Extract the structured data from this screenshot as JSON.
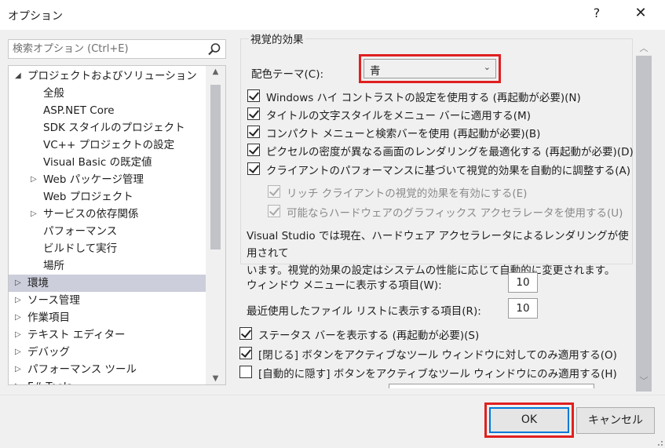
{
  "window": {
    "title": "オプション",
    "help_glyph": "?",
    "close_glyph": "✕"
  },
  "search": {
    "placeholder": "検索オプション (Ctrl+E)"
  },
  "tree": {
    "items": [
      {
        "label": "プロジェクトおよびソリューション",
        "level": 0,
        "expander": "◢",
        "selected": false
      },
      {
        "label": "全般",
        "level": 1,
        "expander": "",
        "selected": false
      },
      {
        "label": "ASP.NET Core",
        "level": 1,
        "expander": "",
        "selected": false
      },
      {
        "label": "SDK スタイルのプロジェクト",
        "level": 1,
        "expander": "",
        "selected": false
      },
      {
        "label": "VC++ プロジェクトの設定",
        "level": 1,
        "expander": "",
        "selected": false
      },
      {
        "label": "Visual Basic の既定値",
        "level": 1,
        "expander": "",
        "selected": false
      },
      {
        "label": "Web パッケージ管理",
        "level": 1,
        "expander": "▷",
        "selected": false
      },
      {
        "label": "Web プロジェクト",
        "level": 1,
        "expander": "",
        "selected": false
      },
      {
        "label": "サービスの依存関係",
        "level": 1,
        "expander": "▷",
        "selected": false
      },
      {
        "label": "パフォーマンス",
        "level": 1,
        "expander": "",
        "selected": false
      },
      {
        "label": "ビルドして実行",
        "level": 1,
        "expander": "",
        "selected": false
      },
      {
        "label": "場所",
        "level": 1,
        "expander": "",
        "selected": false
      },
      {
        "label": "環境",
        "level": 0,
        "expander": "▷",
        "selected": true
      },
      {
        "label": "ソース管理",
        "level": 0,
        "expander": "▷",
        "selected": false
      },
      {
        "label": "作業項目",
        "level": 0,
        "expander": "▷",
        "selected": false
      },
      {
        "label": "テキスト エディター",
        "level": 0,
        "expander": "▷",
        "selected": false
      },
      {
        "label": "デバッグ",
        "level": 0,
        "expander": "▷",
        "selected": false
      },
      {
        "label": "パフォーマンス ツール",
        "level": 0,
        "expander": "▷",
        "selected": false
      },
      {
        "label": "F# Tools",
        "level": 0,
        "expander": "▷",
        "selected": false
      }
    ]
  },
  "visual": {
    "group_title": "視覚的効果",
    "theme_label": "配色テーマ(C):",
    "theme_value": "青",
    "checkboxes": [
      {
        "label": "Windows ハイ コントラストの設定を使用する (再起動が必要)(N)",
        "checked": true,
        "disabled": false
      },
      {
        "label": "タイトルの文字スタイルをメニュー バーに適用する(M)",
        "checked": true,
        "disabled": false
      },
      {
        "label": "コンパクト メニューと検索バーを使用 (再起動が必要)(B)",
        "checked": true,
        "disabled": false
      },
      {
        "label": "ピクセルの密度が異なる画面のレンダリングを最適化する (再起動が必要)(D)",
        "checked": true,
        "disabled": false
      },
      {
        "label": "クライアントのパフォーマンスに基づいて視覚的効果を自動的に調整する(A)",
        "checked": true,
        "disabled": false
      },
      {
        "label": "リッチ クライアントの視覚的効果を有効にする(E)",
        "checked": true,
        "disabled": true
      },
      {
        "label": "可能ならハードウェアのグラフィックス アクセラレータを使用する(U)",
        "checked": true,
        "disabled": true
      }
    ],
    "info_line1": "Visual Studio では現在、ハードウェア アクセラレータによるレンダリングが使用されて",
    "info_line2": "います。視覚的効果の設定はシステムの性能に応じて自動的に変更されます。"
  },
  "window_menu": {
    "label": "ウィンドウ メニューに表示する項目(W):",
    "value": "10"
  },
  "recent_files": {
    "label": "最近使用したファイル リストに表示する項目(R):",
    "value": "10"
  },
  "bottom_checkboxes": [
    {
      "label": "ステータス バーを表示する (再起動が必要)(S)",
      "checked": true
    },
    {
      "label": "[閉じる] ボタンをアクティブなツール ウィンドウに対してのみ適用する(O)",
      "checked": true
    },
    {
      "label": "[自動的に隠す] ボタンをアクティブなツール ウィンドウにのみ適用する(H)",
      "checked": false
    }
  ],
  "buttons": {
    "ok": "OK",
    "cancel": "キャンセル"
  },
  "colors": {
    "highlight_red": "#e02020",
    "selection": "#cccedb",
    "focus_blue": "#0078d7"
  }
}
